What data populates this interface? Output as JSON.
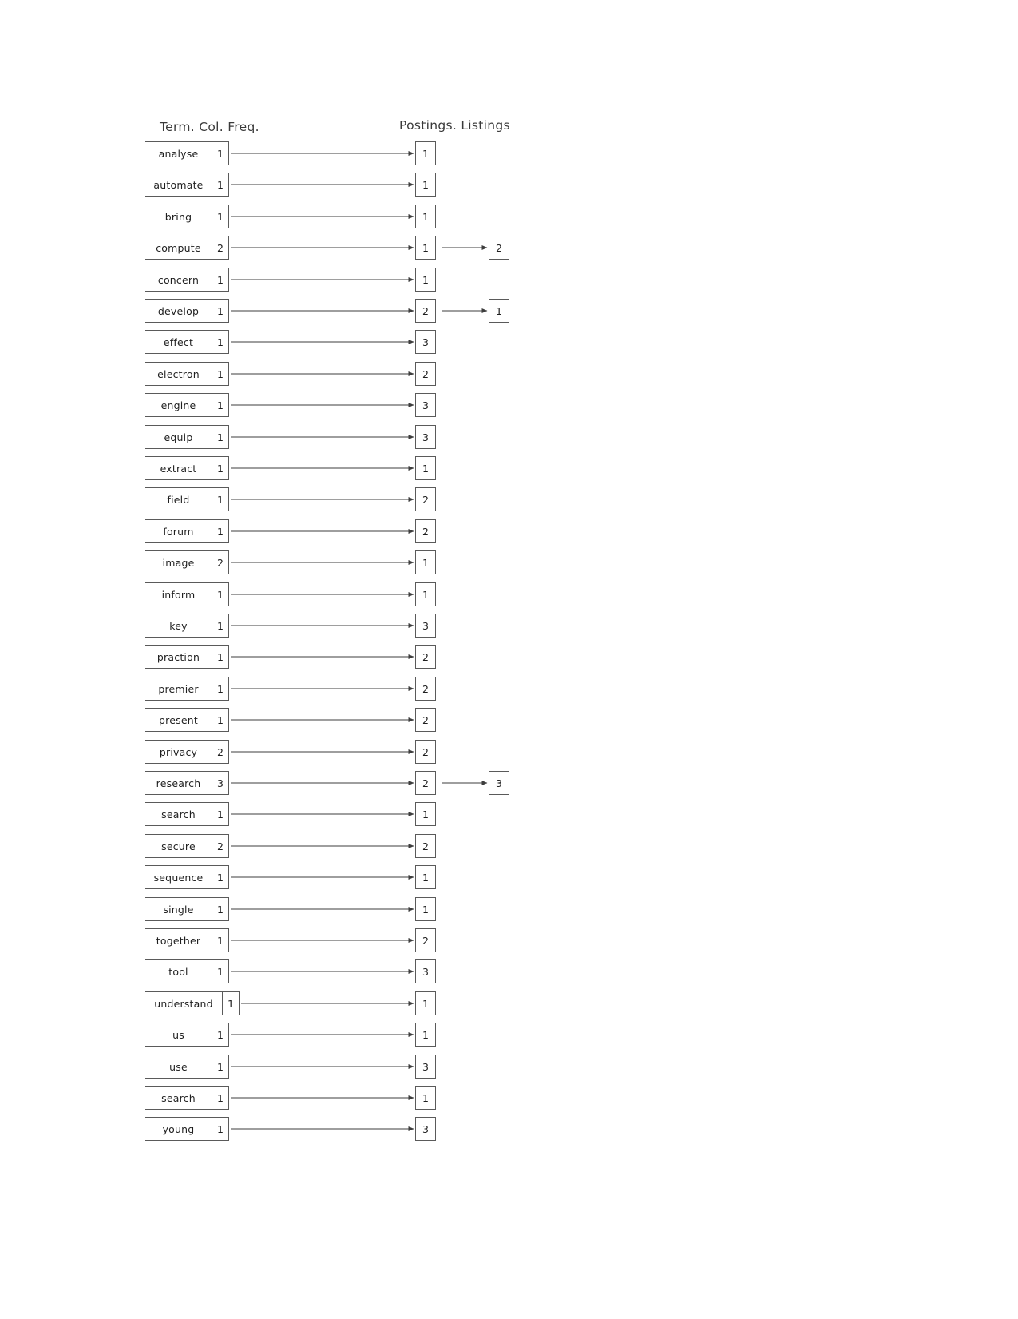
{
  "headers": {
    "term_column": "Term. Col. Freq.",
    "postings_column": "Postings. Listings"
  },
  "colors": {
    "box_border": "#5a5a5a",
    "text": "#1f1f1f",
    "header_text": "#3a3a3a",
    "arrow": "#3d3d3d",
    "background": "#ffffff"
  },
  "rows": [
    {
      "term": "analyse",
      "freq": "1",
      "posting": "1",
      "posting2": null
    },
    {
      "term": "automate",
      "freq": "1",
      "posting": "1",
      "posting2": null
    },
    {
      "term": "bring",
      "freq": "1",
      "posting": "1",
      "posting2": null
    },
    {
      "term": "compute",
      "freq": "2",
      "posting": "1",
      "posting2": "2"
    },
    {
      "term": "concern",
      "freq": "1",
      "posting": "1",
      "posting2": null
    },
    {
      "term": "develop",
      "freq": "1",
      "posting": "2",
      "posting2": "1"
    },
    {
      "term": "effect",
      "freq": "1",
      "posting": "3",
      "posting2": null
    },
    {
      "term": "electron",
      "freq": "1",
      "posting": "2",
      "posting2": null
    },
    {
      "term": "engine",
      "freq": "1",
      "posting": "3",
      "posting2": null
    },
    {
      "term": "equip",
      "freq": "1",
      "posting": "3",
      "posting2": null
    },
    {
      "term": "extract",
      "freq": "1",
      "posting": "1",
      "posting2": null
    },
    {
      "term": "field",
      "freq": "1",
      "posting": "2",
      "posting2": null
    },
    {
      "term": "forum",
      "freq": "1",
      "posting": "2",
      "posting2": null
    },
    {
      "term": "image",
      "freq": "2",
      "posting": "1",
      "posting2": null
    },
    {
      "term": "inform",
      "freq": "1",
      "posting": "1",
      "posting2": null
    },
    {
      "term": "key",
      "freq": "1",
      "posting": "3",
      "posting2": null
    },
    {
      "term": "praction",
      "freq": "1",
      "posting": "2",
      "posting2": null
    },
    {
      "term": "premier",
      "freq": "1",
      "posting": "2",
      "posting2": null
    },
    {
      "term": "present",
      "freq": "1",
      "posting": "2",
      "posting2": null
    },
    {
      "term": "privacy",
      "freq": "2",
      "posting": "2",
      "posting2": null
    },
    {
      "term": "research",
      "freq": "3",
      "posting": "2",
      "posting2": "3"
    },
    {
      "term": "search",
      "freq": "1",
      "posting": "1",
      "posting2": null
    },
    {
      "term": "secure",
      "freq": "2",
      "posting": "2",
      "posting2": null
    },
    {
      "term": "sequence",
      "freq": "1",
      "posting": "1",
      "posting2": null
    },
    {
      "term": "single",
      "freq": "1",
      "posting": "1",
      "posting2": null
    },
    {
      "term": "together",
      "freq": "1",
      "posting": "2",
      "posting2": null
    },
    {
      "term": "tool",
      "freq": "1",
      "posting": "3",
      "posting2": null
    },
    {
      "term": "understand",
      "freq": "1",
      "posting": "1",
      "posting2": null
    },
    {
      "term": "us",
      "freq": "1",
      "posting": "1",
      "posting2": null
    },
    {
      "term": "use",
      "freq": "1",
      "posting": "3",
      "posting2": null
    },
    {
      "term": "search",
      "freq": "1",
      "posting": "1",
      "posting2": null
    },
    {
      "term": "young",
      "freq": "1",
      "posting": "3",
      "posting2": null
    }
  ],
  "chart_data": {
    "type": "table",
    "title": "Inverted index: dictionary and postings lists",
    "columns": [
      "Term",
      "Col. Freq.",
      "Postings. Listings",
      "Postings. Listings (2)"
    ],
    "rows": [
      [
        "analyse",
        1,
        1,
        null
      ],
      [
        "automate",
        1,
        1,
        null
      ],
      [
        "bring",
        1,
        1,
        null
      ],
      [
        "compute",
        2,
        1,
        2
      ],
      [
        "concern",
        1,
        1,
        null
      ],
      [
        "develop",
        1,
        2,
        1
      ],
      [
        "effect",
        1,
        3,
        null
      ],
      [
        "electron",
        1,
        2,
        null
      ],
      [
        "engine",
        1,
        3,
        null
      ],
      [
        "equip",
        1,
        3,
        null
      ],
      [
        "extract",
        1,
        1,
        null
      ],
      [
        "field",
        1,
        2,
        null
      ],
      [
        "forum",
        1,
        2,
        null
      ],
      [
        "image",
        2,
        1,
        null
      ],
      [
        "inform",
        1,
        1,
        null
      ],
      [
        "key",
        1,
        3,
        null
      ],
      [
        "praction",
        1,
        2,
        null
      ],
      [
        "premier",
        1,
        2,
        null
      ],
      [
        "present",
        1,
        2,
        null
      ],
      [
        "privacy",
        2,
        2,
        null
      ],
      [
        "research",
        3,
        2,
        3
      ],
      [
        "search",
        1,
        1,
        null
      ],
      [
        "secure",
        2,
        2,
        null
      ],
      [
        "sequence",
        1,
        1,
        null
      ],
      [
        "single",
        1,
        1,
        null
      ],
      [
        "together",
        1,
        2,
        null
      ],
      [
        "tool",
        1,
        3,
        null
      ],
      [
        "understand",
        1,
        1,
        null
      ],
      [
        "us",
        1,
        1,
        null
      ],
      [
        "use",
        1,
        3,
        null
      ],
      [
        "search",
        1,
        1,
        null
      ],
      [
        "young",
        1,
        3,
        null
      ]
    ]
  }
}
